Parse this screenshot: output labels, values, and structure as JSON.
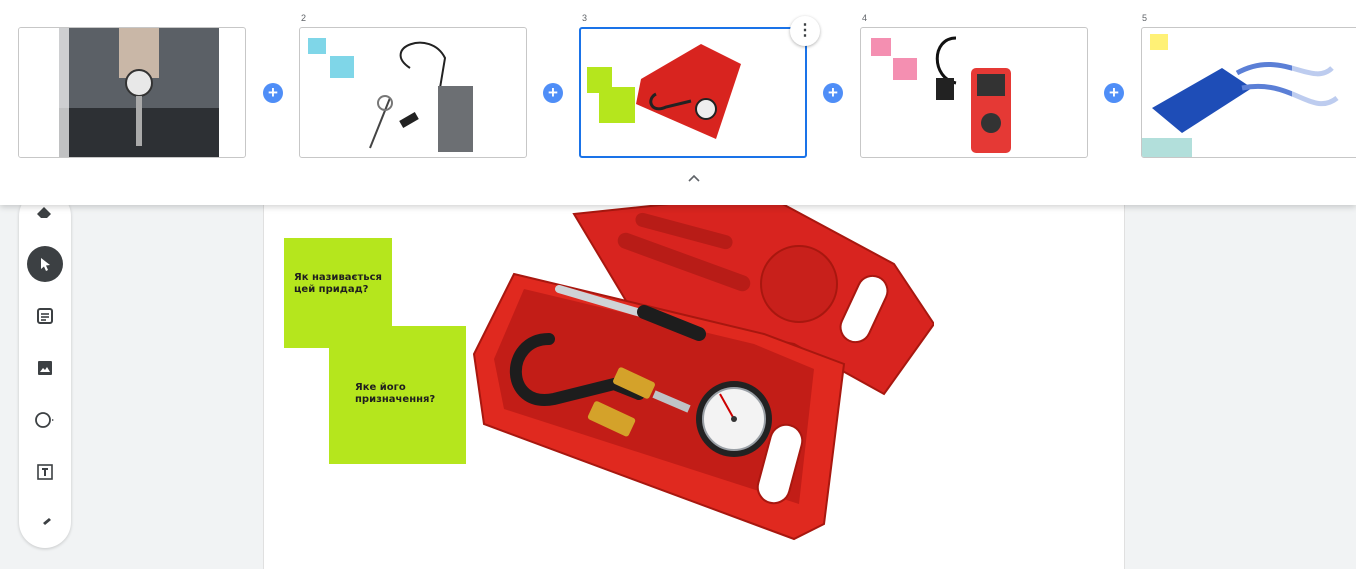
{
  "filmstrip": {
    "prev_label": "‹",
    "next_label": "›",
    "collapse_icon": "chevron-up-icon",
    "more_label": "⋮",
    "add_label": "+",
    "slides": [
      {
        "number": ""
      },
      {
        "number": "2"
      },
      {
        "number": "3",
        "selected": true
      },
      {
        "number": "4"
      },
      {
        "number": "5"
      }
    ]
  },
  "toolbar": {
    "tools": [
      "eraser-icon",
      "select-pointer-icon",
      "sticky-note-icon",
      "image-icon",
      "shape-icon",
      "text-box-icon",
      "laser-icon"
    ],
    "active_tool": "select-pointer-icon"
  },
  "board": {
    "note1": "Як називається цей придад?",
    "note2": "Яке його призначення?"
  },
  "colors": {
    "note_green": "#b5e61d",
    "case_red": "#d8241f",
    "accent_blue": "#1a73e8",
    "add_blue": "#4f8ef7"
  }
}
